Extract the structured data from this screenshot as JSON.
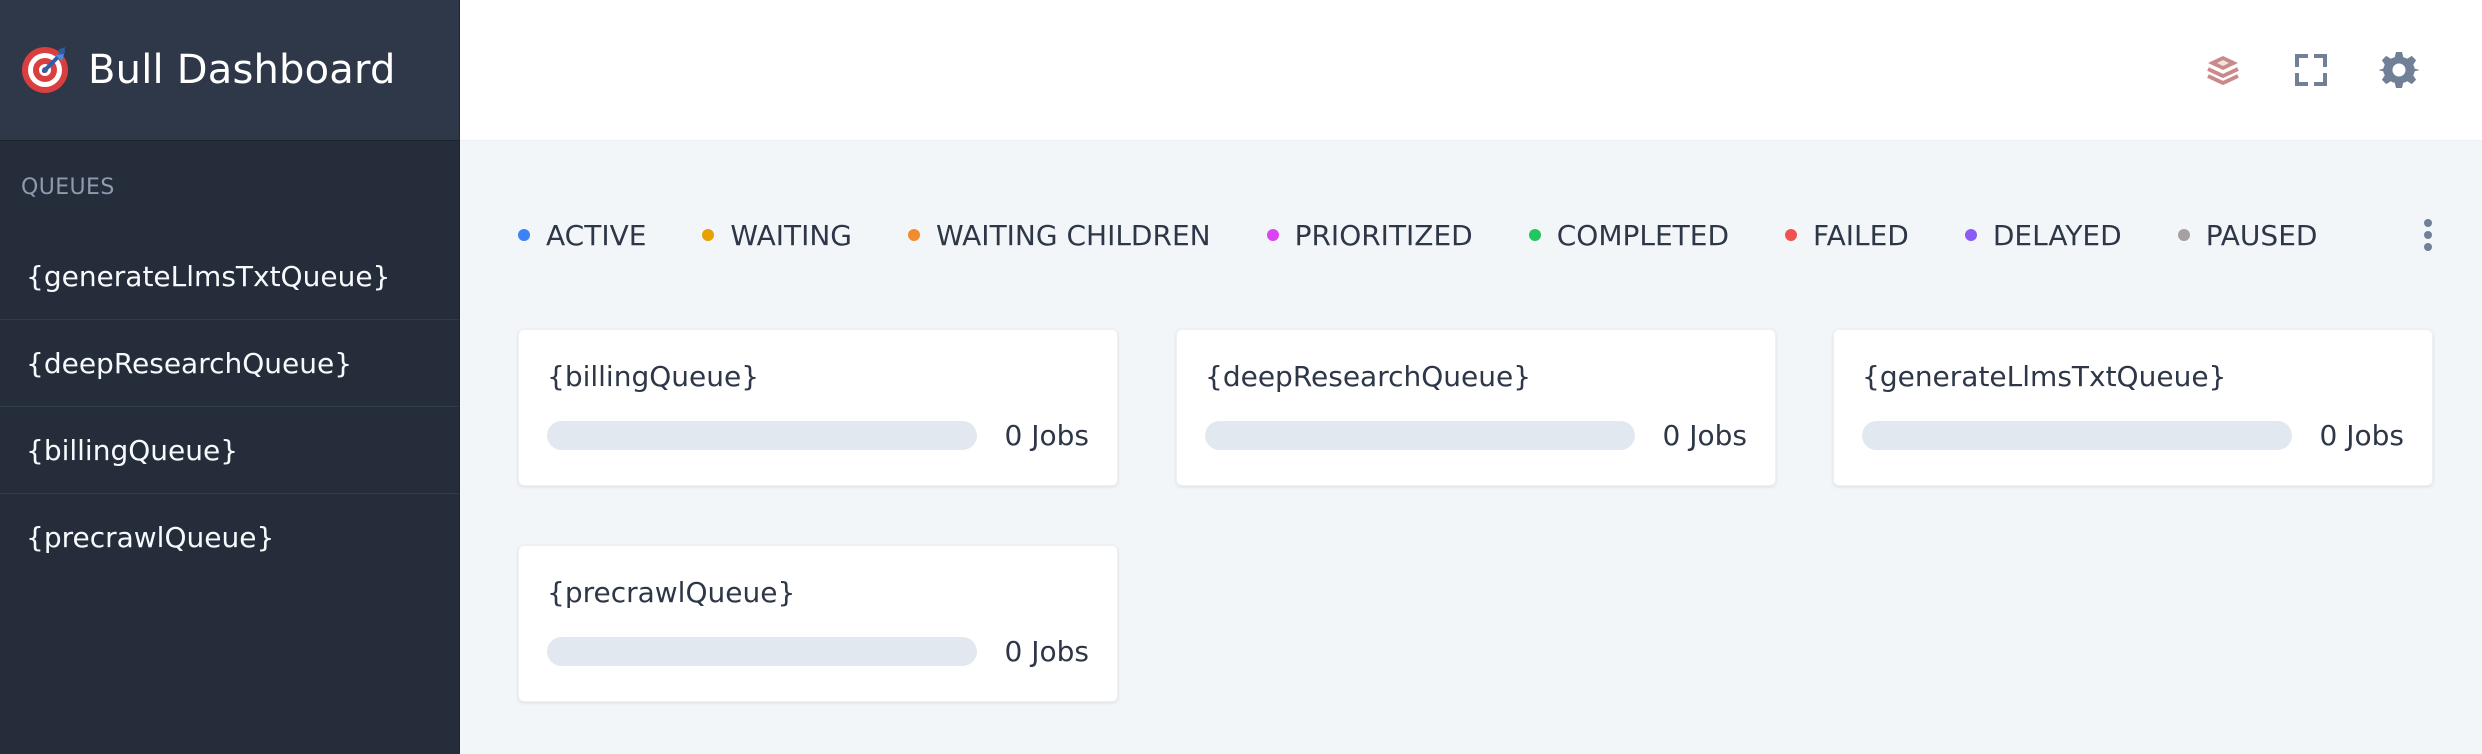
{
  "app": {
    "title": "Bull Dashboard",
    "logo_icon": "target-icon",
    "colors": {
      "sidebar_background": "#252d3b",
      "sidebar_header_background": "#2f3848",
      "main_background": "#f3f6f9",
      "card_background": "#ffffff",
      "progress_track": "#e2e8f0",
      "text": "#2d3748"
    }
  },
  "sidebar": {
    "section_label": "QUEUES",
    "items": [
      {
        "label": "{generateLlmsTxtQueue}"
      },
      {
        "label": "{deepResearchQueue}"
      },
      {
        "label": "{billingQueue}"
      },
      {
        "label": "{precrawlQueue}"
      }
    ]
  },
  "header": {
    "icons": [
      {
        "name": "redis-icon",
        "color": "#c98a89"
      },
      {
        "name": "fullscreen-icon",
        "color": "#718096"
      },
      {
        "name": "gear-icon",
        "color": "#718096"
      }
    ]
  },
  "statuses": [
    {
      "label": "ACTIVE",
      "color": "#3b82f6"
    },
    {
      "label": "WAITING",
      "color": "#e6a100"
    },
    {
      "label": "WAITING CHILDREN",
      "color": "#f08c2e"
    },
    {
      "label": "PRIORITIZED",
      "color": "#d946ef"
    },
    {
      "label": "COMPLETED",
      "color": "#22c55e"
    },
    {
      "label": "FAILED",
      "color": "#ef5350"
    },
    {
      "label": "DELAYED",
      "color": "#8b5cf6"
    },
    {
      "label": "PAUSED",
      "color": "#a6a0a0"
    }
  ],
  "more_icon": "vertical-ellipsis-icon",
  "queues": [
    {
      "name": "{billingQueue}",
      "jobs_label": "0 Jobs",
      "progress": 0
    },
    {
      "name": "{deepResearchQueue}",
      "jobs_label": "0 Jobs",
      "progress": 0
    },
    {
      "name": "{generateLlmsTxtQueue}",
      "jobs_label": "0 Jobs",
      "progress": 0
    },
    {
      "name": "{precrawlQueue}",
      "jobs_label": "0 Jobs",
      "progress": 0
    }
  ]
}
